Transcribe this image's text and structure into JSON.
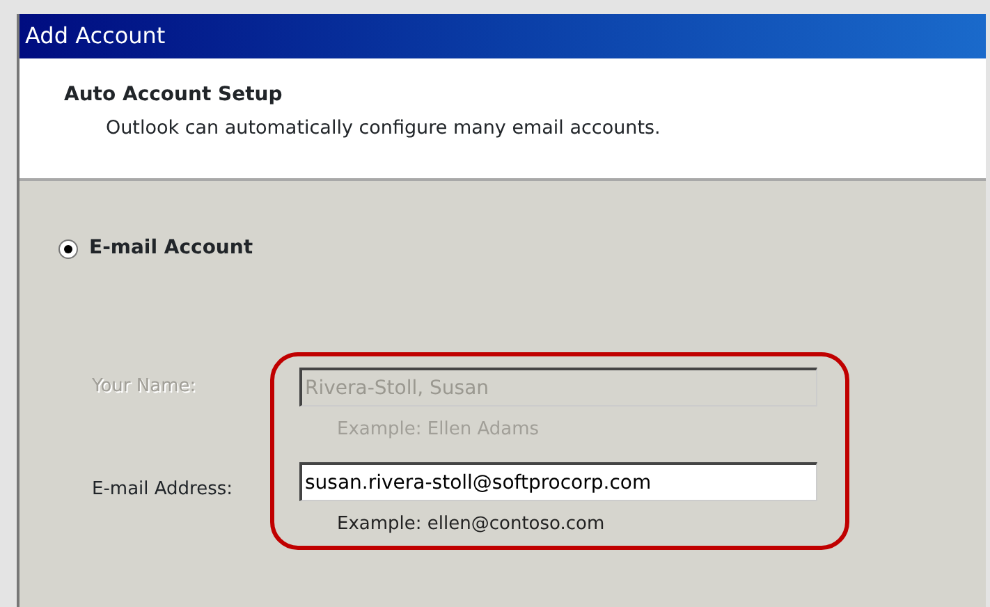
{
  "window": {
    "title": "Add Account"
  },
  "header": {
    "title": "Auto Account Setup",
    "subtitle": "Outlook can automatically configure many email accounts."
  },
  "account_option": {
    "label": "E-mail Account",
    "selected": true
  },
  "fields": [
    {
      "label": "Your Name:",
      "value": "Rivera-Stoll, Susan",
      "example": "Example: Ellen Adams",
      "disabled": true
    },
    {
      "label": "E-mail Address:",
      "value": "susan.rivera-stoll@softprocorp.com",
      "example": "Example: ellen@contoso.com",
      "disabled": false
    }
  ]
}
